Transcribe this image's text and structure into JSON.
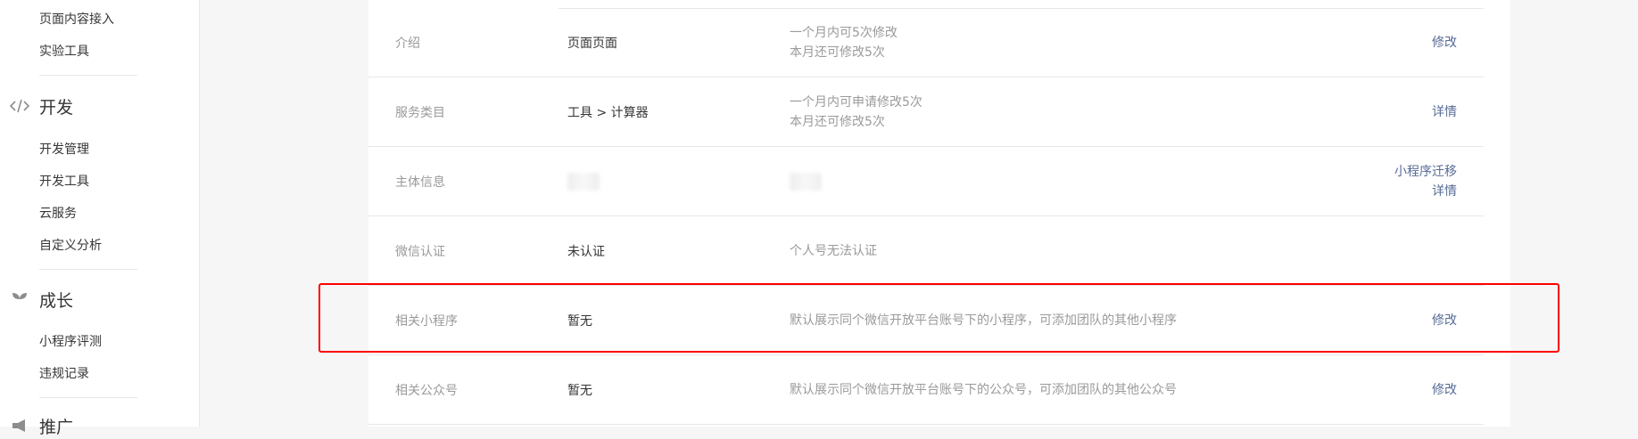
{
  "sidebar": {
    "top_items": [
      "页面内容接入",
      "实验工具"
    ],
    "sections": [
      {
        "title": "开发",
        "icon": "code-icon",
        "items": [
          "开发管理",
          "开发工具",
          "云服务",
          "自定义分析"
        ]
      },
      {
        "title": "成长",
        "icon": "sprout-icon",
        "items": [
          "小程序评测",
          "违规记录"
        ]
      },
      {
        "title": "推广",
        "icon": "megaphone-icon",
        "items": []
      }
    ]
  },
  "settings": {
    "rows": [
      {
        "label": "介绍",
        "value": "页面页面",
        "desc": [
          "一个月内可5次修改",
          "本月还可修改5次"
        ],
        "actions": [
          "修改"
        ]
      },
      {
        "label": "服务类目",
        "value": "工具 > 计算器",
        "desc": [
          "一个月内可申请修改5次",
          "本月还可修改5次"
        ],
        "actions": [
          "详情"
        ]
      },
      {
        "label": "主体信息",
        "value": "",
        "desc": [],
        "actions": [
          "小程序迁移",
          "详情"
        ]
      },
      {
        "label": "微信认证",
        "value": "未认证",
        "desc": [
          "个人号无法认证"
        ],
        "actions": []
      },
      {
        "label": "相关小程序",
        "value": "暂无",
        "desc": [
          "默认展示同个微信开放平台账号下的小程序，可添加团队的其他小程序"
        ],
        "actions": [
          "修改"
        ]
      },
      {
        "label": "相关公众号",
        "value": "暂无",
        "desc": [
          "默认展示同个微信开放平台账号下的公众号，可添加团队的其他公众号"
        ],
        "actions": [
          "修改"
        ]
      }
    ]
  },
  "colors": {
    "link": "#576b95",
    "highlight": "#ff0000",
    "muted": "#9a9a9a"
  }
}
